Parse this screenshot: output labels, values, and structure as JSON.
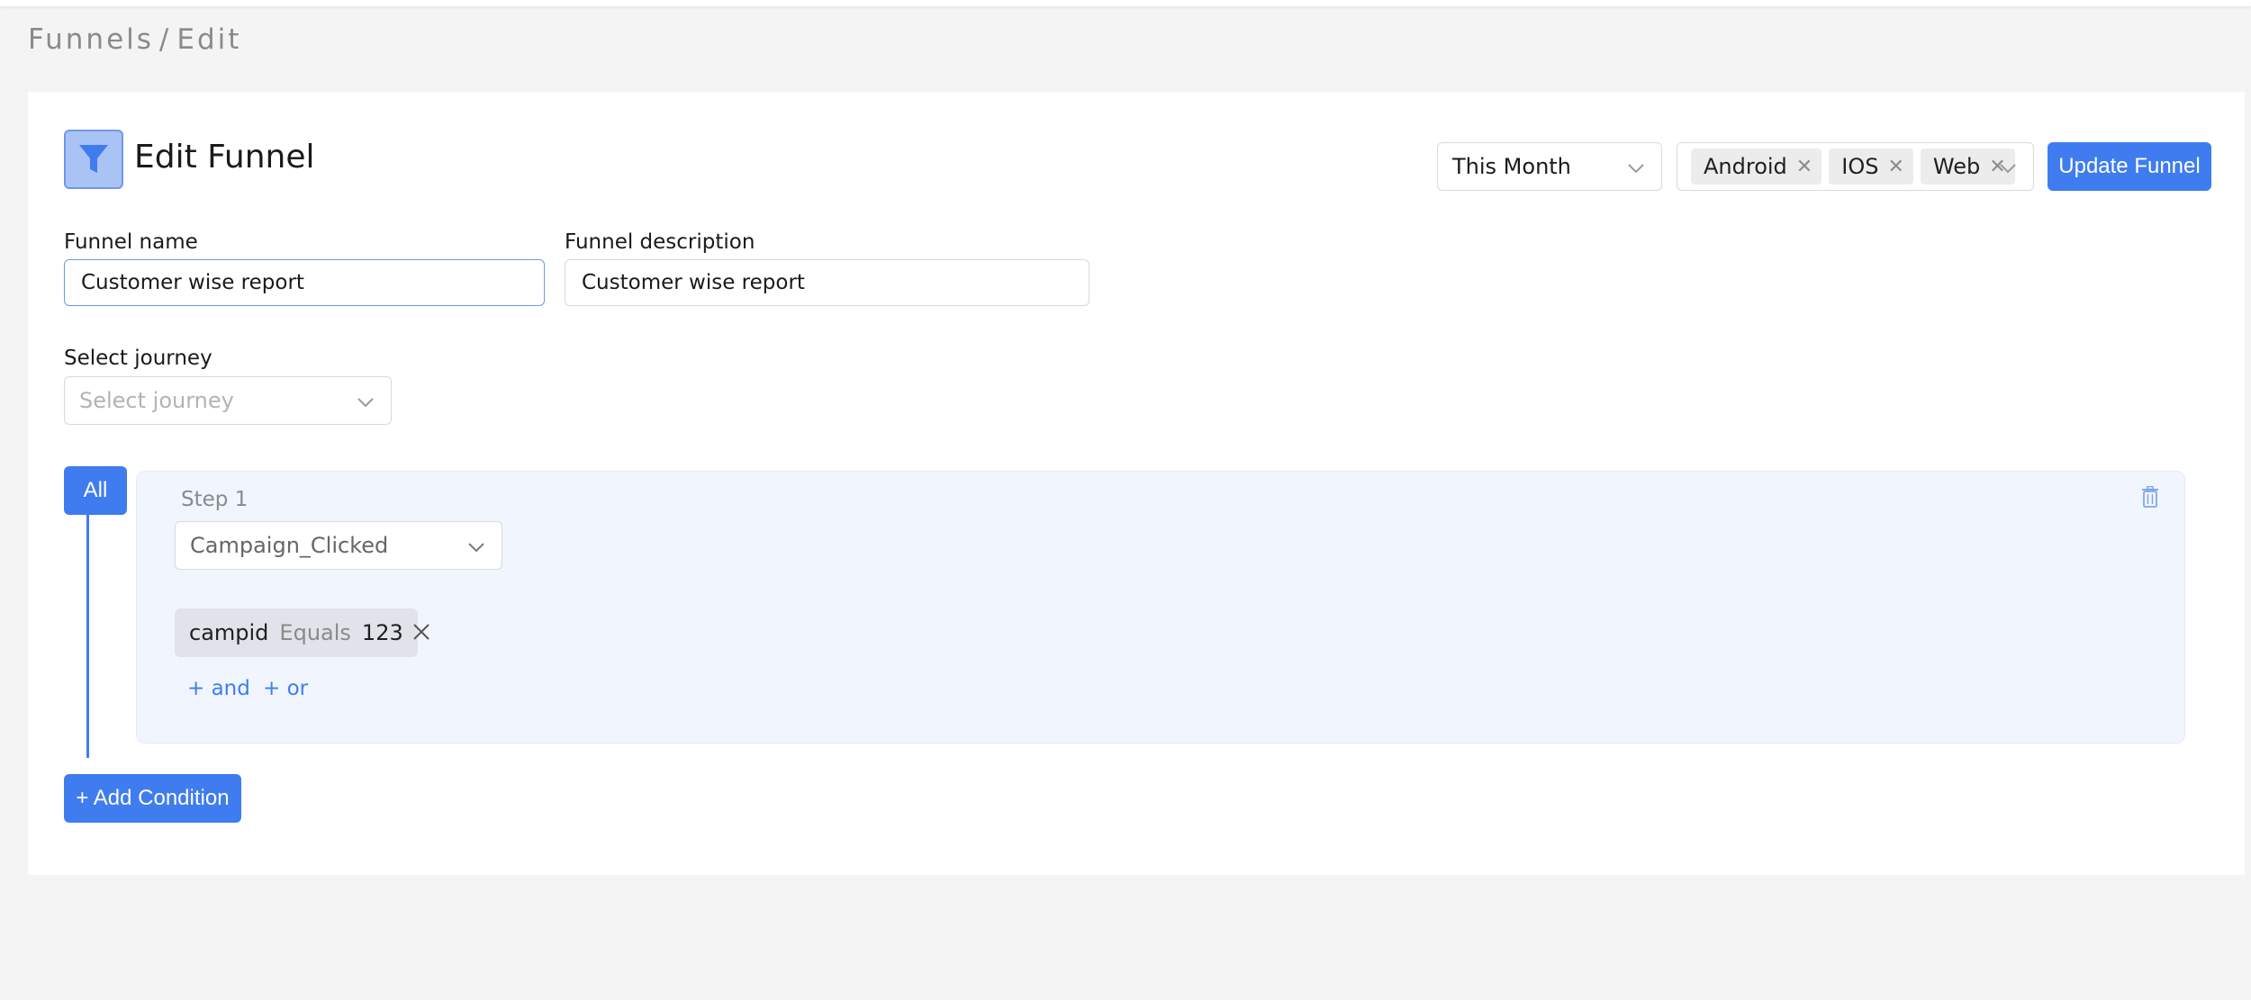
{
  "breadcrumb": {
    "items": [
      "Funnels",
      "/",
      "Edit"
    ]
  },
  "header": {
    "title": "Edit Funnel",
    "icon": "filter-icon"
  },
  "toolbar": {
    "date_range": "This Month",
    "platforms": [
      "Android",
      "IOS",
      "Web"
    ],
    "update_label": "Update Funnel"
  },
  "form": {
    "name_label": "Funnel name",
    "name_value": "Customer wise report",
    "desc_label": "Funnel description",
    "desc_value": "Customer wise report",
    "journey_label": "Select journey",
    "journey_placeholder": "Select journey"
  },
  "steps": {
    "all_label": "All",
    "step1": {
      "label": "Step 1",
      "event": "Campaign_Clicked",
      "condition": {
        "property": "campid",
        "operator": "Equals",
        "value": "123"
      },
      "and_label": "+ and",
      "or_label": "+ or"
    }
  },
  "add_condition_label": "+ Add Condition",
  "colors": {
    "accent": "#3f7cf0",
    "page_bg": "#f4f4f4",
    "step_bg": "#f1f6fe"
  }
}
